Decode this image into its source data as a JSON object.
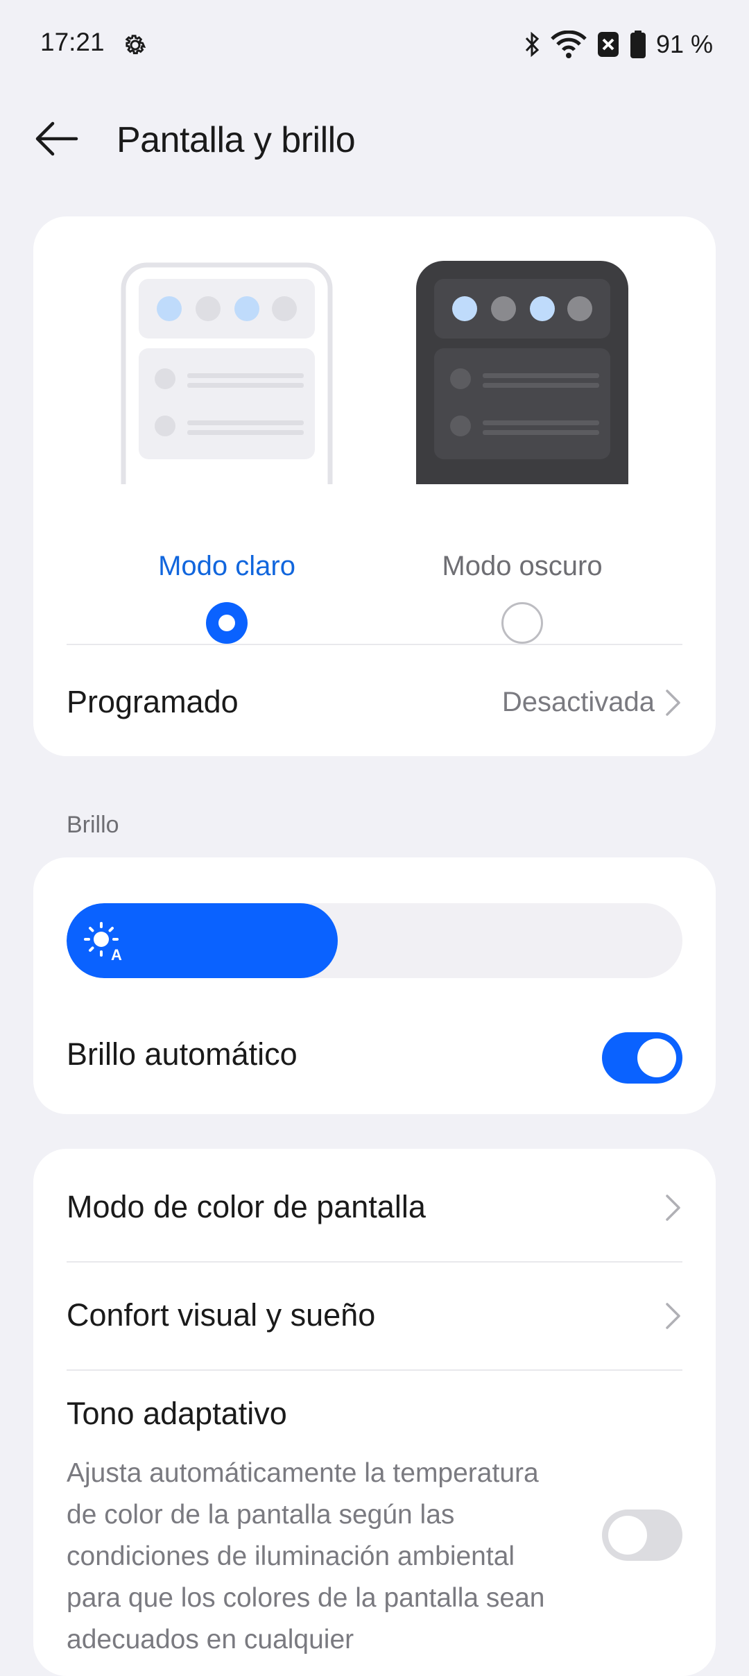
{
  "status_bar": {
    "time": "17:21",
    "battery": "91 %"
  },
  "header": {
    "title": "Pantalla y brillo"
  },
  "theme": {
    "light_label": "Modo claro",
    "dark_label": "Modo oscuro",
    "selected": "light",
    "scheduled_label": "Programado",
    "scheduled_value": "Desactivada"
  },
  "brightness": {
    "section_label": "Brillo",
    "level": 0.44,
    "auto_label": "Brillo automático",
    "auto_enabled": true
  },
  "display": {
    "color_mode_label": "Modo de color de pantalla",
    "comfort_label": "Confort visual y sueño",
    "adaptive_tone_label": "Tono adaptativo",
    "adaptive_tone_desc": "Ajusta automáticamente la temperatura de color de la pantalla según las condiciones de iluminación ambiental para que los colores de la pantalla sean adecuados en cualquier",
    "adaptive_tone_enabled": false
  },
  "colors": {
    "accent": "#0a62ff",
    "selected_text": "#1166dd",
    "background": "#f1f1f6"
  }
}
